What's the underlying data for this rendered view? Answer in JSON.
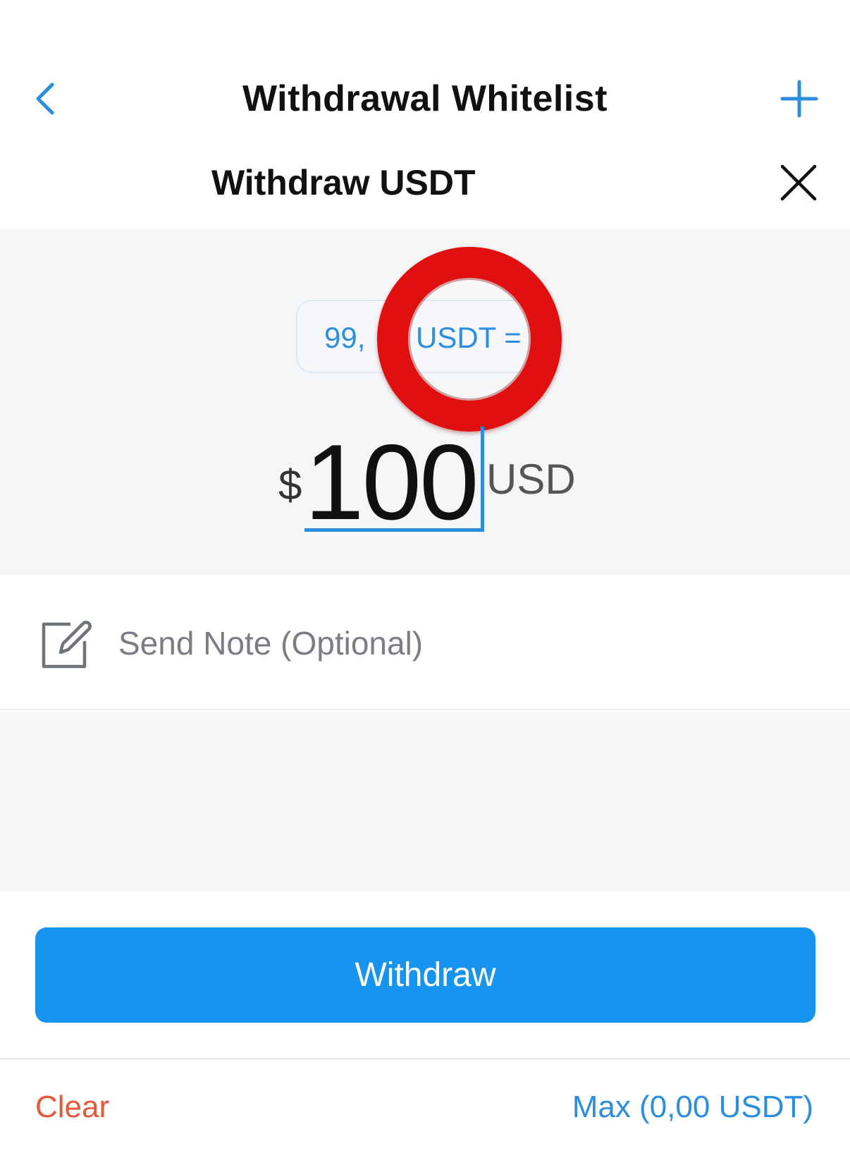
{
  "navbar": {
    "title": "Withdrawal Whitelist",
    "back_icon": "chevron-left-icon",
    "add_icon": "plus-icon"
  },
  "sheet": {
    "title": "Withdraw USDT",
    "close_icon": "close-icon"
  },
  "amount": {
    "rate_left": "99,",
    "rate_right": "USDT =",
    "currency_symbol": "$",
    "value": "100",
    "currency": "USD"
  },
  "note": {
    "icon": "edit-note-icon",
    "placeholder": "Send Note (Optional)"
  },
  "actions": {
    "withdraw_label": "Withdraw",
    "clear_label": "Clear",
    "max_label": "Max (0,00 USDT)"
  },
  "colors": {
    "accent": "#1793f0",
    "link": "#2d8ee0",
    "danger": "#e35a3a",
    "annotation_ring": "#e01010"
  }
}
